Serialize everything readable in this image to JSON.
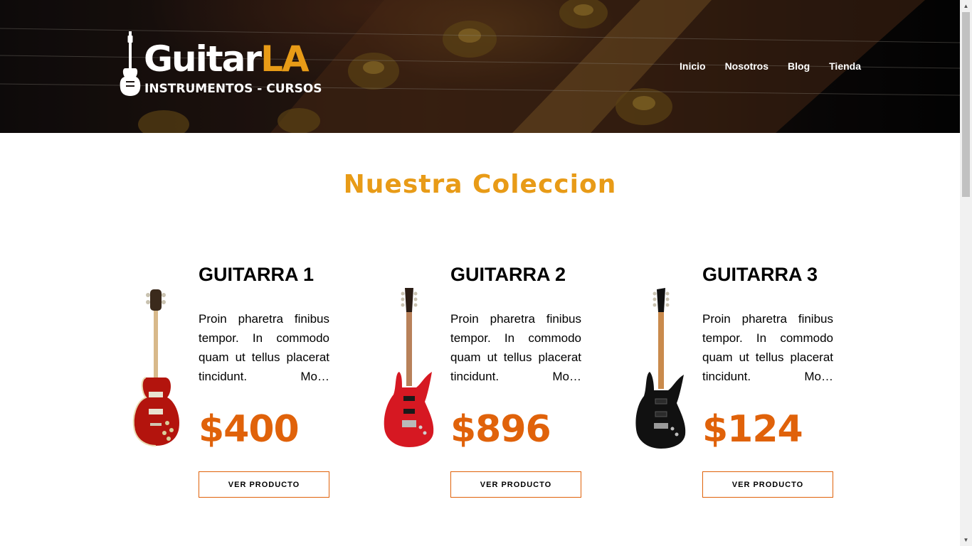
{
  "header": {
    "logo": {
      "word_main": "Guitar",
      "word_accent": "LA",
      "tagline": "INSTRUMENTOS - CURSOS"
    },
    "nav": [
      "Inicio",
      "Nosotros",
      "Blog",
      "Tienda"
    ]
  },
  "main": {
    "title": "Nuestra Coleccion",
    "products": [
      {
        "name": "GUITARRA 1",
        "description": "Proin pharetra finibus tempor. In commodo quam ut tellus placerat tincidunt. Mo…",
        "price": "$400",
        "button": "VER PRODUCTO",
        "image_icon": "red-les-paul-guitar-image",
        "body_color": "#b3140d"
      },
      {
        "name": "GUITARRA 2",
        "description": "Proin pharetra finibus tempor. In commodo quam ut tellus placerat tincidunt. Mo…",
        "price": "$896",
        "button": "VER PRODUCTO",
        "image_icon": "red-superstrat-guitar-image",
        "body_color": "#d61822"
      },
      {
        "name": "GUITARRA 3",
        "description": "Proin pharetra finibus tempor. In commodo quam ut tellus placerat tincidunt. Mo…",
        "price": "$124",
        "button": "VER PRODUCTO",
        "image_icon": "black-superstrat-guitar-image",
        "body_color": "#111111"
      }
    ]
  },
  "colors": {
    "accent": "#e89b17",
    "price": "#e0620a",
    "button_border": "#e0620a"
  }
}
